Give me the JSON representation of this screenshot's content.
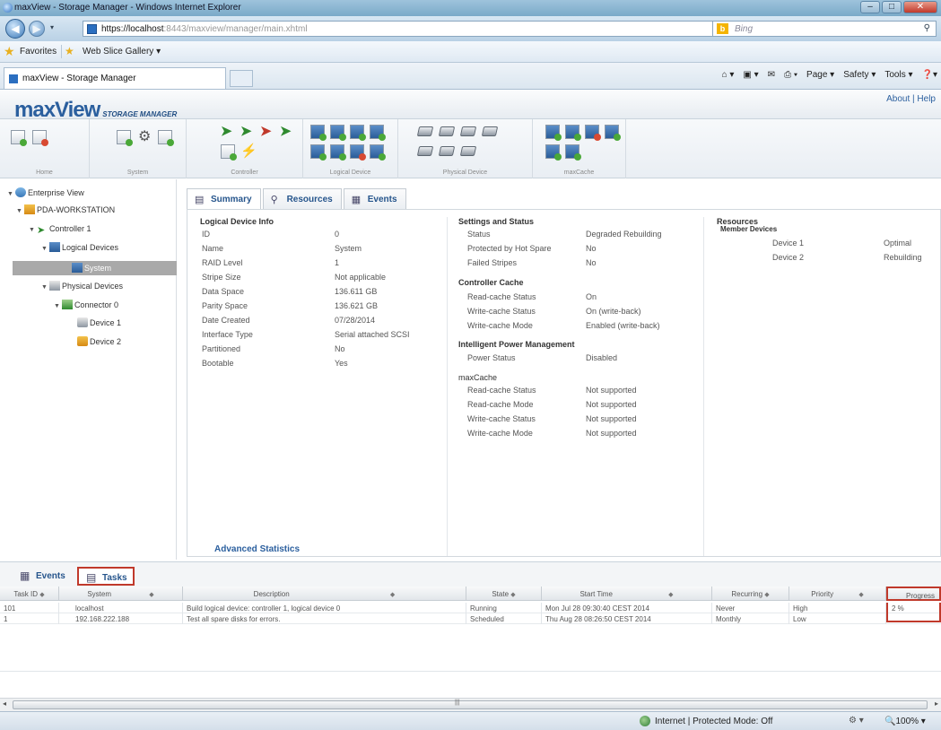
{
  "window": {
    "title": "maxView - Storage Manager - Windows Internet Explorer"
  },
  "browser": {
    "url_host": "https://localhost",
    "url_rest": ":8443/maxview/manager/main.xhtml",
    "search_placeholder": "Bing",
    "favorites_label": "Favorites",
    "web_slice_label": "Web Slice Gallery ▾",
    "tab_title": "maxView - Storage Manager",
    "cmd_page": "Page ▾",
    "cmd_safety": "Safety ▾",
    "cmd_tools": "Tools ▾",
    "cmd_help": "❓▾"
  },
  "header": {
    "logo": "maxView",
    "logo_sub": "STORAGE MANAGER",
    "links": "About  |  Help"
  },
  "ribbon": {
    "groups": [
      {
        "label": "Home"
      },
      {
        "label": "System"
      },
      {
        "label": "Controller"
      },
      {
        "label": "Logical Device"
      },
      {
        "label": "Physical Device"
      },
      {
        "label": "maxCache"
      }
    ]
  },
  "tree": {
    "items": [
      {
        "label": "Enterprise View"
      },
      {
        "label": "PDA-WORKSTATION"
      },
      {
        "label": "Controller 1"
      },
      {
        "label": "Logical Devices"
      },
      {
        "label": "System"
      },
      {
        "label": "Physical Devices"
      },
      {
        "label": "Connector 0"
      },
      {
        "label": "Device 1"
      },
      {
        "label": "Device 2"
      }
    ]
  },
  "panel_tabs": [
    {
      "label": "Summary"
    },
    {
      "label": "Resources"
    },
    {
      "label": "Events"
    }
  ],
  "ldinfo": {
    "title": "Logical Device Info",
    "rows": [
      {
        "k": "ID",
        "v": "0"
      },
      {
        "k": "Name",
        "v": "System"
      },
      {
        "k": "RAID Level",
        "v": "1"
      },
      {
        "k": "Stripe Size",
        "v": "Not applicable"
      },
      {
        "k": "Data Space",
        "v": "136.611 GB"
      },
      {
        "k": "Parity Space",
        "v": "136.621 GB"
      },
      {
        "k": "Date Created",
        "v": "07/28/2014"
      },
      {
        "k": "Interface Type",
        "v": "Serial attached SCSI"
      },
      {
        "k": "Partitioned",
        "v": "No"
      },
      {
        "k": "Bootable",
        "v": "Yes"
      }
    ],
    "advanced": "Advanced Statistics"
  },
  "settings": {
    "title": "Settings and Status",
    "rows": [
      {
        "k": "Status",
        "v": "Degraded Rebuilding"
      },
      {
        "k": "Protected by Hot Spare",
        "v": "No"
      },
      {
        "k": "Failed Stripes",
        "v": "No"
      }
    ],
    "cache_title": "Controller Cache",
    "cache_rows": [
      {
        "k": "Read-cache Status",
        "v": "On"
      },
      {
        "k": "Write-cache Status",
        "v": "On (write-back)"
      },
      {
        "k": "Write-cache Mode",
        "v": "Enabled (write-back)"
      }
    ],
    "ipm_title": "Intelligent Power Management",
    "ipm_rows": [
      {
        "k": "Power Status",
        "v": "Disabled"
      }
    ],
    "maxcache_title": "maxCache",
    "maxcache_rows": [
      {
        "k": "Read-cache Status",
        "v": "Not supported"
      },
      {
        "k": "Read-cache Mode",
        "v": "Not supported"
      },
      {
        "k": "Write-cache Status",
        "v": "Not supported"
      },
      {
        "k": "Write-cache Mode",
        "v": "Not supported"
      }
    ]
  },
  "resources": {
    "title": "Resources",
    "subtitle": "Member Devices",
    "rows": [
      {
        "k": "Device 1",
        "v": "Optimal"
      },
      {
        "k": "Device 2",
        "v": "Rebuilding"
      }
    ]
  },
  "bottom_tabs": [
    {
      "label": "Events"
    },
    {
      "label": "Tasks"
    }
  ],
  "tasks": {
    "columns": [
      {
        "label": "Task ID"
      },
      {
        "label": "System"
      },
      {
        "label": "Description"
      },
      {
        "label": "State"
      },
      {
        "label": "Start Time"
      },
      {
        "label": "Recurring"
      },
      {
        "label": "Priority"
      },
      {
        "label": "Progress"
      }
    ],
    "rows": [
      {
        "id": "101",
        "system": "localhost",
        "description": "Build logical device: controller 1, logical device 0",
        "state": "Running",
        "start": "Mon Jul 28 09:30:40 CEST 2014",
        "recurring": "Never",
        "priority": "High",
        "progress": "2 %"
      },
      {
        "id": "1",
        "system": "192.168.222.188",
        "description": "Test all spare disks for errors.",
        "state": "Scheduled",
        "start": "Thu Aug 28 08:26:50 CEST 2014",
        "recurring": "Monthly",
        "priority": "Low",
        "progress": ""
      }
    ]
  },
  "statusbar": {
    "zone": "Internet | Protected Mode: Off",
    "zoom": "100%"
  }
}
